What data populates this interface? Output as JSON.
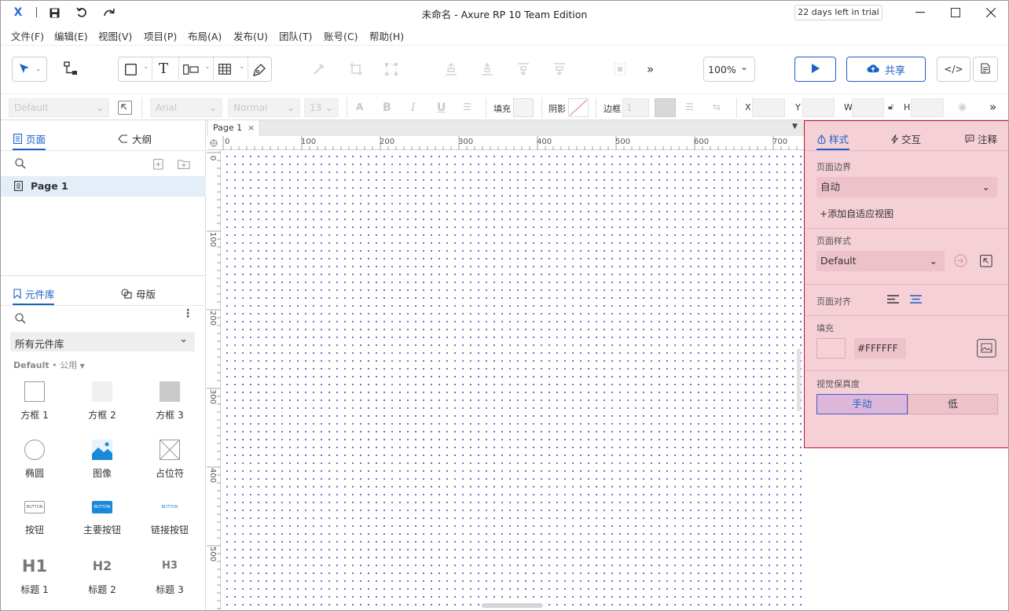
{
  "window": {
    "title": "未命名 - Axure RP 10 Team Edition",
    "trial_badge": "22 days left in trial"
  },
  "menu": [
    "文件(F)",
    "编辑(E)",
    "视图(V)",
    "项目(P)",
    "布局(A)",
    "发布(U)",
    "团队(T)",
    "账号(C)",
    "帮助(H)"
  ],
  "toolbar": {
    "zoom": "100%",
    "share_label": "共享",
    "more": "»"
  },
  "formatbar": {
    "style_select": "Default",
    "font_family": "Arial",
    "font_weight": "Normal",
    "font_size": "13",
    "fill_label": "填充",
    "shadow_label": "阴影",
    "border_label": "边框",
    "border_width": "1",
    "x_label": "X",
    "y_label": "Y",
    "w_label": "W",
    "h_label": "H"
  },
  "left_top": {
    "tab_pages": "页面",
    "tab_outline": "大纲",
    "page_item": "Page 1"
  },
  "library": {
    "tab_library": "元件库",
    "tab_masters": "母版",
    "selector": "所有元件库",
    "group_default": "Default",
    "group_sep": "•",
    "group_public": "公用",
    "items": [
      {
        "label": "方框 1",
        "icon": "box1-icon"
      },
      {
        "label": "方框 2",
        "icon": "box2-icon"
      },
      {
        "label": "方框 3",
        "icon": "box3-icon"
      },
      {
        "label": "椭圆",
        "icon": "ellipse-icon"
      },
      {
        "label": "图像",
        "icon": "image-icon"
      },
      {
        "label": "占位符",
        "icon": "placeholder-icon"
      },
      {
        "label": "按钮",
        "icon": "button-icon"
      },
      {
        "label": "主要按钮",
        "icon": "primary-button-icon"
      },
      {
        "label": "链接按钮",
        "icon": "link-button-icon"
      },
      {
        "label": "标题 1",
        "icon": "heading1-icon"
      },
      {
        "label": "标题 2",
        "icon": "heading2-icon"
      },
      {
        "label": "标题 3",
        "icon": "heading3-icon"
      }
    ],
    "button_text": "BUTTON",
    "h1": "H1",
    "h2": "H2",
    "h3": "H3"
  },
  "canvas": {
    "tab": "Page 1",
    "ruler_h": [
      "0",
      "100",
      "200",
      "300",
      "400",
      "500",
      "600",
      "700"
    ],
    "ruler_v": [
      "0",
      "100",
      "200",
      "300",
      "400",
      "500"
    ]
  },
  "inspector": {
    "tab_style": "样式",
    "tab_interact": "交互",
    "tab_notes": "注释",
    "page_bounds_label": "页面边界",
    "page_bounds_value": "自动",
    "add_adaptive": "添加自适应视图",
    "page_style_label": "页面样式",
    "page_style_value": "Default",
    "page_align_label": "页面对齐",
    "fill_label": "填充",
    "fill_hex": "#FFFFFF",
    "fidelity_label": "视觉保真度",
    "fidelity_manual": "手动",
    "fidelity_low": "低",
    "colors": {
      "accent": "#1a61c8",
      "panel_bg": "#f6d0d7",
      "panel_border": "#c2182b"
    }
  }
}
